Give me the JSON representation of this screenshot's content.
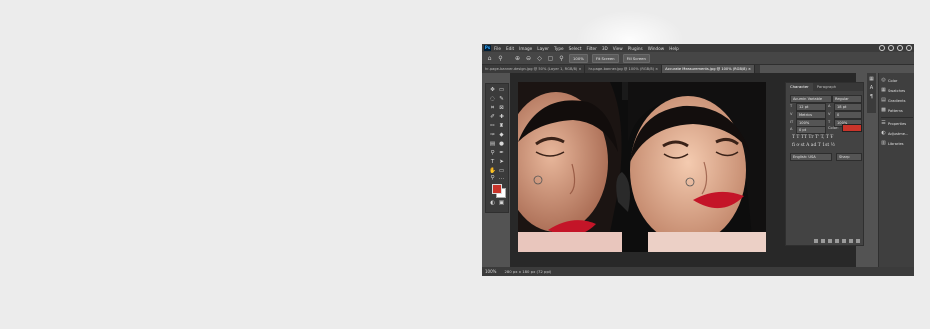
{
  "menubar": {
    "logo": "Ps",
    "items": [
      "File",
      "Edit",
      "Image",
      "Layer",
      "Type",
      "Select",
      "Filter",
      "3D",
      "View",
      "Plugins",
      "Window",
      "Help"
    ]
  },
  "options": {
    "zoom_value": "100%",
    "fit_screen": "Fit Screen",
    "fill_screen": "Fill Screen"
  },
  "tabs": [
    "hr-page-banner-design.jpg @ 50% (Layer 1, RGB/8) ×",
    "hr-page-banner.jpg @ 100% (RGB/8) ×",
    "Accurate Measurements.jpg @ 100% (RGB/8) ×"
  ],
  "status": {
    "zoom": "100%",
    "dimensions": "280 px x 180 px (72 ppi)"
  },
  "character": {
    "tab_character": "Character",
    "tab_paragraph": "Paragraph",
    "font_family": "Acumin Variable",
    "font_style": "Regular",
    "font_size": "12 pt",
    "leading": "18 pt",
    "kerning": "Metrics",
    "tracking": "0",
    "vscale": "100%",
    "hscale": "100%",
    "baseline": "0 pt",
    "color_label": "Color:",
    "glyphs_row1": "T T TT Tr T' T, T Ŧ",
    "glyphs_row2": "fi ơ st A ad T 1st ½",
    "language": "English: USA",
    "antialias": "Sharp",
    "text_color": "#c9342a"
  },
  "dock": {
    "items": [
      "Color",
      "Swatches",
      "Gradients",
      "Patterns",
      "Properties",
      "Adjustme...",
      "Libraries"
    ]
  },
  "colors": {
    "foreground": "#c9342a",
    "background": "#ffffff",
    "app_bg": "#535353"
  }
}
